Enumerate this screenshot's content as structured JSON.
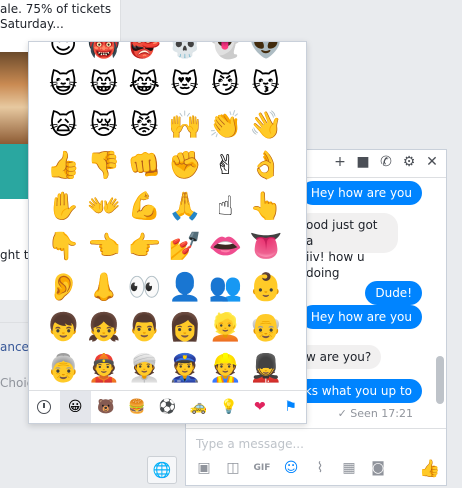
{
  "background": {
    "line1": "ale. 75% of tickets",
    "line2": "Saturday...",
    "ght_to": "ght to",
    "ance": "ance)",
    "choic": "Choic"
  },
  "chat": {
    "messages": [
      {
        "side": "out",
        "text": "Hey how are you"
      },
      {
        "side": "in",
        "text": "ood just got a\niiv! how u doing"
      },
      {
        "side": "out",
        "text": "Dude!"
      },
      {
        "side": "out",
        "text": "Hey how are you"
      },
      {
        "side": "in",
        "text": "w are you?"
      },
      {
        "side": "out",
        "text": "anks what you up to"
      }
    ],
    "seen": "✓ Seen 17:21",
    "placeholder": "Type a message..."
  },
  "emoji_rows": [
    [
      "😈",
      "👹",
      "👺",
      "💀",
      "👻",
      "👽"
    ],
    [
      "😺",
      "😸",
      "😹",
      "😻",
      "😼",
      "😽"
    ],
    [
      "🙀",
      "😿",
      "😾",
      "🙌",
      "👏",
      "👋"
    ],
    [
      "👍",
      "👎",
      "👊",
      "✊",
      "✌",
      "👌"
    ],
    [
      "✋",
      "👐",
      "💪",
      "🙏",
      "☝",
      "👆"
    ],
    [
      "👇",
      "👈",
      "👉",
      "💅",
      "👄",
      "👅"
    ],
    [
      "👂",
      "👃",
      "👀",
      "👤",
      "👥",
      "👶"
    ],
    [
      "👦",
      "👧",
      "👨",
      "👩",
      "👱",
      "👴"
    ],
    [
      "👵",
      "👲",
      "👳",
      "👮",
      "👷",
      "💂"
    ]
  ],
  "picker_tabs": [
    {
      "name": "recent",
      "glyph": ""
    },
    {
      "name": "smileys",
      "glyph": "😀"
    },
    {
      "name": "animals",
      "glyph": "🐻"
    },
    {
      "name": "food",
      "glyph": "🍔"
    },
    {
      "name": "activity",
      "glyph": "⚽"
    },
    {
      "name": "travel",
      "glyph": "🚕"
    },
    {
      "name": "objects",
      "glyph": "💡"
    },
    {
      "name": "symbols",
      "glyph": "❤"
    },
    {
      "name": "flags",
      "glyph": "⚑"
    }
  ],
  "colors": {
    "accent": "#0084ff",
    "bubble_in": "#f1f0f0",
    "teal": "#2aa7a0"
  }
}
